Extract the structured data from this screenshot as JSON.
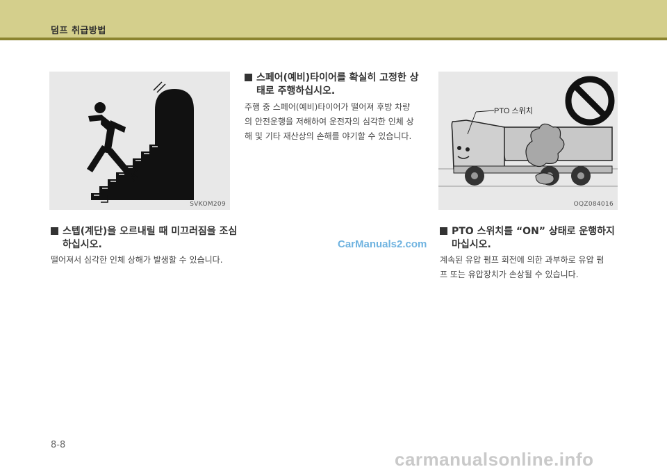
{
  "header": {
    "title": "덤프 취급방법"
  },
  "left": {
    "figure_code": "SVKOM209",
    "title_line1": "스텝(계단)을 오르내릴 때 미끄러짐을 조심",
    "title_line2": "하십시오.",
    "body": "떨어져서 심각한 인체 상해가 발생할 수 있습니다."
  },
  "middle": {
    "title_line1": "스페어(예비)타이어를 확실히 고정한 상",
    "title_line2": "태로 주행하십시오.",
    "body_line1": "주행 중 스페어(예비)타이어가 떨어져 후방 차량",
    "body_line2": "의 안전운행을 저해하여 운전자의 심각한 인체 상",
    "body_line3": "해 및 기타 재산상의 손해를 야기할 수 있습니다."
  },
  "right": {
    "figure_code": "OQZ084016",
    "figure_label": "PTO 스위치",
    "title_line1": "PTO 스위치를 “ON” 상태로 운행하지",
    "title_line2": "마십시오.",
    "body_line1": "계속된 유압 펌프 회전에 의한 과부하로 유압 펌",
    "body_line2": "프 또는 유압장치가 손상될 수 있습니다."
  },
  "watermark_top": "CarManuals2.com",
  "watermark_bottom": "carmanualsonline.info",
  "page_number": "8-8"
}
